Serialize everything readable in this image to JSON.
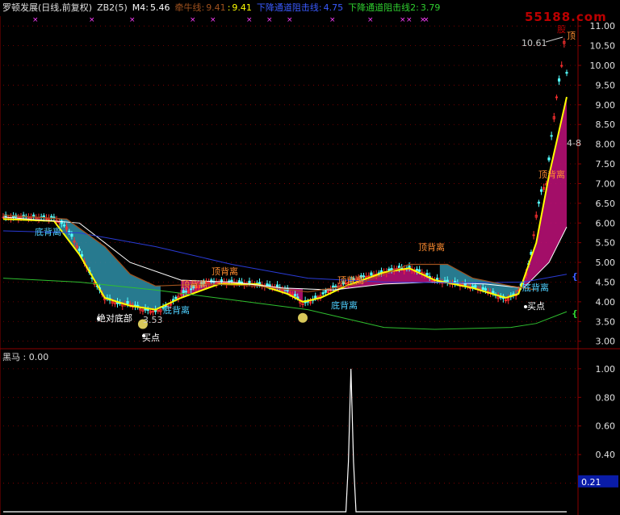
{
  "header": {
    "title": "罗顿发展(日线,前复权)",
    "indicator": "ZB2(5)",
    "m4_label": "M4:",
    "m4_value": "5.46",
    "qianniu_label": "牵牛线:",
    "qianniu_value1": "9.41",
    "qianniu_value2": "9.41",
    "down_resist1_label": "下降通道阻击线:",
    "down_resist1_value": "4.75",
    "down_resist2_label": "下降通道阻击线2:",
    "down_resist2_value": "3.79"
  },
  "watermark": {
    "line1": "55188.com",
    "line2": "股"
  },
  "sub_header": {
    "label": "黑马 :",
    "value": "0.00"
  },
  "colors": {
    "background": "#000000",
    "up_candle": "#ff3030",
    "down_candle": "#54ffff",
    "yellow_line": "#ffff00",
    "white_line": "#ffffff",
    "blue_line": "#2a3bd6",
    "green_line": "#2fbf2f",
    "brown_line": "#a0521e",
    "teal_band": "#2e8fa8",
    "magenta_band": "#c0107a",
    "grid_red": "#8b0000"
  },
  "annotations": [
    {
      "text": "底背离",
      "color": "#4fd0ff"
    },
    {
      "text": "绝对底部",
      "color": "#ffffff"
    },
    {
      "text": "3.53",
      "color": "#cccccc"
    },
    {
      "text": "买点",
      "color": "#ffffff"
    },
    {
      "text": "底背离",
      "color": "#4fd0ff"
    },
    {
      "text": "顶背离",
      "color": "#ff8c30"
    },
    {
      "text": "顶背离",
      "color": "#ff8c30"
    },
    {
      "text": "顶背离",
      "color": "#ff8c30"
    },
    {
      "text": "底背离",
      "color": "#4fd0ff"
    },
    {
      "text": "顶背离",
      "color": "#ff8c30"
    },
    {
      "text": "底背离",
      "color": "#4fd0ff"
    },
    {
      "text": "买点",
      "color": "#ffffff"
    },
    {
      "text": "10.61",
      "color": "#cccccc"
    },
    {
      "text": "顶",
      "color": "#ff8c30"
    },
    {
      "text": "顶背离",
      "color": "#ff8c30"
    },
    {
      "text": "4-8",
      "color": "#cccccc"
    }
  ],
  "chart_data": [
    {
      "type": "line",
      "title": "罗顿发展(日线,前复权)",
      "yticks": [
        3.0,
        3.5,
        4.0,
        4.5,
        5.0,
        5.5,
        6.0,
        6.5,
        7.0,
        7.5,
        8.0,
        8.5,
        9.0,
        9.5,
        10.0,
        10.5,
        11.0
      ],
      "ylim": [
        2.85,
        11.25
      ],
      "n_bars": 160,
      "labeled_low": 3.53,
      "labeled_high": 10.61,
      "price_points": [
        [
          0,
          6.15
        ],
        [
          10,
          6.15
        ],
        [
          20,
          6.12
        ],
        [
          25,
          5.9
        ],
        [
          30,
          5.3
        ],
        [
          35,
          4.6
        ],
        [
          40,
          4.1
        ],
        [
          45,
          3.95
        ],
        [
          50,
          3.95
        ],
        [
          55,
          3.8
        ],
        [
          60,
          3.75
        ],
        [
          65,
          3.9
        ],
        [
          70,
          4.2
        ],
        [
          75,
          4.35
        ],
        [
          80,
          4.5
        ],
        [
          90,
          4.5
        ],
        [
          100,
          4.45
        ],
        [
          110,
          4.35
        ],
        [
          115,
          4.15
        ],
        [
          118,
          3.95
        ],
        [
          122,
          4.05
        ],
        [
          130,
          4.35
        ],
        [
          140,
          4.6
        ],
        [
          150,
          4.75
        ],
        [
          155,
          4.85
        ],
        [
          160,
          4.85
        ],
        [
          165,
          4.75
        ],
        [
          170,
          4.55
        ],
        [
          180,
          4.45
        ],
        [
          190,
          4.3
        ],
        [
          198,
          4.05
        ],
        [
          202,
          4.2
        ],
        [
          205,
          4.5
        ],
        [
          208,
          5.2
        ],
        [
          210,
          6.2
        ],
        [
          212,
          6.8
        ],
        [
          214,
          7.0
        ],
        [
          216,
          8.2
        ],
        [
          218,
          9.2
        ],
        [
          220,
          10.0
        ],
        [
          221,
          10.61
        ],
        [
          222,
          9.8
        ]
      ],
      "series": [
        {
          "name": "M4",
          "points": [
            [
              0,
              6.1
            ],
            [
              20,
              6.05
            ],
            [
              30,
              5.2
            ],
            [
              40,
              4.1
            ],
            [
              50,
              3.9
            ],
            [
              60,
              3.8
            ],
            [
              70,
              4.1
            ],
            [
              85,
              4.45
            ],
            [
              100,
              4.45
            ],
            [
              112,
              4.2
            ],
            [
              118,
              4.0
            ],
            [
              125,
              4.1
            ],
            [
              135,
              4.4
            ],
            [
              150,
              4.75
            ],
            [
              160,
              4.85
            ],
            [
              170,
              4.55
            ],
            [
              185,
              4.35
            ],
            [
              198,
              4.1
            ],
            [
              203,
              4.2
            ],
            [
              210,
              5.5
            ],
            [
              215,
              7.2
            ],
            [
              222,
              9.2
            ]
          ]
        },
        {
          "name": "",
          "points": [
            [
              0,
              6.15
            ],
            [
              30,
              6.0
            ],
            [
              50,
              5.0
            ],
            [
              70,
              4.55
            ],
            [
              90,
              4.5
            ],
            [
              110,
              4.35
            ],
            [
              130,
              4.3
            ],
            [
              150,
              4.45
            ],
            [
              170,
              4.5
            ],
            [
              190,
              4.45
            ],
            [
              205,
              4.35
            ],
            [
              215,
              5.0
            ],
            [
              222,
              5.9
            ]
          ]
        },
        {
          "name": "",
          "points": [
            [
              0,
              5.8
            ],
            [
              30,
              5.75
            ],
            [
              60,
              5.4
            ],
            [
              90,
              4.95
            ],
            [
              120,
              4.6
            ],
            [
              150,
              4.5
            ],
            [
              180,
              4.48
            ],
            [
              205,
              4.5
            ],
            [
              222,
              4.7
            ]
          ]
        },
        {
          "name": "",
          "points": [
            [
              0,
              4.6
            ],
            [
              30,
              4.5
            ],
            [
              60,
              4.3
            ],
            [
              90,
              4.05
            ],
            [
              120,
              3.8
            ],
            [
              150,
              3.35
            ],
            [
              170,
              3.3
            ],
            [
              200,
              3.35
            ],
            [
              210,
              3.45
            ],
            [
              222,
              3.75
            ]
          ]
        },
        {
          "name": "",
          "points": [
            [
              0,
              6.2
            ],
            [
              25,
              6.1
            ],
            [
              40,
              5.4
            ],
            [
              50,
              4.7
            ],
            [
              60,
              4.4
            ],
            [
              80,
              4.45
            ],
            [
              100,
              4.4
            ],
            [
              120,
              4.25
            ],
            [
              140,
              4.45
            ],
            [
              160,
              4.95
            ],
            [
              175,
              4.95
            ],
            [
              185,
              4.6
            ],
            [
              200,
              4.4
            ],
            [
              210,
              4.3
            ]
          ]
        }
      ]
    },
    {
      "type": "line",
      "title": "黑马",
      "yticks": [
        0.2,
        0.4,
        0.6,
        0.8,
        1.0
      ],
      "ylim": [
        0,
        1.05
      ],
      "cursor_value": "0.21",
      "series": [
        {
          "name": "黑马",
          "points": [
            [
              0,
              0
            ],
            [
              135,
              0
            ],
            [
              136,
              0.35
            ],
            [
              137,
              1.0
            ],
            [
              138,
              0.35
            ],
            [
              139,
              0
            ],
            [
              222,
              0
            ]
          ]
        }
      ]
    }
  ]
}
